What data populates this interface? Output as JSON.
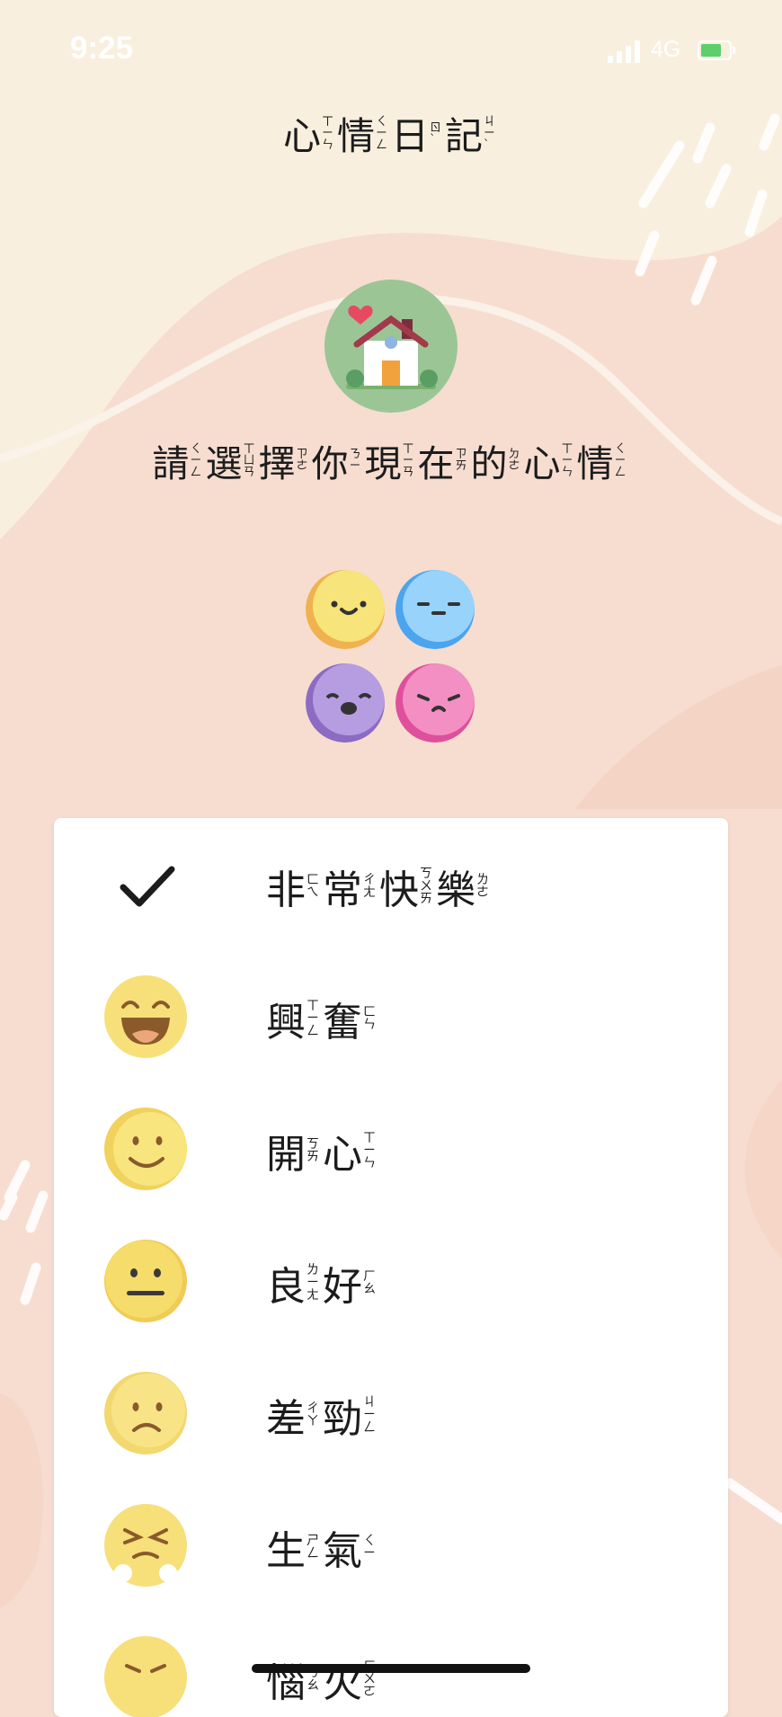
{
  "status_bar": {
    "time": "9:25",
    "network": "4G"
  },
  "header": {
    "title": [
      {
        "han": "心",
        "bpm": [
          "ㄒ",
          "ㄧ",
          "ㄣ"
        ]
      },
      {
        "han": "情",
        "bpm": [
          "ㄑ",
          "ㄧ",
          "ㄥ"
        ]
      },
      {
        "han": "日",
        "bpm": [
          "ㄖ",
          "ˋ"
        ]
      },
      {
        "han": "記",
        "bpm": [
          "ㄐ",
          "ㄧ",
          "ˋ"
        ]
      }
    ]
  },
  "prompt": [
    {
      "han": "請",
      "bpm": [
        "ㄑ",
        "ㄧ",
        "ㄥ"
      ]
    },
    {
      "han": "選",
      "bpm": [
        "ㄒ",
        "ㄩ",
        "ㄢ"
      ]
    },
    {
      "han": "擇",
      "bpm": [
        "ㄗ",
        "ㄜ"
      ]
    },
    {
      "han": "你",
      "bpm": [
        "ㄋ",
        "ㄧ"
      ]
    },
    {
      "han": "現",
      "bpm": [
        "ㄒ",
        "ㄧ",
        "ㄢ"
      ]
    },
    {
      "han": "在",
      "bpm": [
        "ㄗ",
        "ㄞ"
      ]
    },
    {
      "han": "的",
      "bpm": [
        "ㄉ",
        "ㄜ"
      ]
    },
    {
      "han": "心",
      "bpm": [
        "ㄒ",
        "ㄧ",
        "ㄣ"
      ]
    },
    {
      "han": "情",
      "bpm": [
        "ㄑ",
        "ㄧ",
        "ㄥ"
      ]
    }
  ],
  "mood_options": [
    {
      "icon": "checkmark-icon",
      "selected": true,
      "label": [
        {
          "han": "非",
          "bpm": [
            "ㄈ",
            "ㄟ"
          ]
        },
        {
          "han": "常",
          "bpm": [
            "ㄔ",
            "ㄤ"
          ]
        },
        {
          "han": "快",
          "bpm": [
            "ㄎ",
            "ㄨ",
            "ㄞ"
          ]
        },
        {
          "han": "樂",
          "bpm": [
            "ㄌ",
            "ㄜ"
          ]
        }
      ]
    },
    {
      "icon": "grinning-face-icon",
      "selected": false,
      "label": [
        {
          "han": "興",
          "bpm": [
            "ㄒ",
            "ㄧ",
            "ㄥ"
          ]
        },
        {
          "han": "奮",
          "bpm": [
            "ㄈ",
            "ㄣ"
          ]
        }
      ]
    },
    {
      "icon": "smiling-face-icon",
      "selected": false,
      "label": [
        {
          "han": "開",
          "bpm": [
            "ㄎ",
            "ㄞ"
          ]
        },
        {
          "han": "心",
          "bpm": [
            "ㄒ",
            "ㄧ",
            "ㄣ"
          ]
        }
      ]
    },
    {
      "icon": "neutral-face-icon",
      "selected": false,
      "label": [
        {
          "han": "良",
          "bpm": [
            "ㄌ",
            "ㄧ",
            "ㄤ"
          ]
        },
        {
          "han": "好",
          "bpm": [
            "ㄏ",
            "ㄠ"
          ]
        }
      ]
    },
    {
      "icon": "sad-face-icon",
      "selected": false,
      "label": [
        {
          "han": "差",
          "bpm": [
            "ㄔ",
            "ㄚ"
          ]
        },
        {
          "han": "勁",
          "bpm": [
            "ㄐ",
            "ㄧ",
            "ㄥ"
          ]
        }
      ]
    },
    {
      "icon": "angry-face-icon",
      "selected": false,
      "label": [
        {
          "han": "生",
          "bpm": [
            "ㄕ",
            "ㄥ"
          ]
        },
        {
          "han": "氣",
          "bpm": [
            "ㄑ",
            "ㄧ"
          ]
        }
      ]
    },
    {
      "icon": "furious-face-icon",
      "selected": false,
      "label": [
        {
          "han": "惱",
          "bpm": [
            "ㄋ",
            "ㄠ"
          ]
        },
        {
          "han": "火",
          "bpm": [
            "ㄏ",
            "ㄨ",
            "ㄛ"
          ]
        }
      ]
    }
  ],
  "colors": {
    "background": "#f6ddd0",
    "top_band": "#f8efdf",
    "card": "#ffffff",
    "house_circle": "#9cc596",
    "face_yellow": "#f7e27a"
  }
}
